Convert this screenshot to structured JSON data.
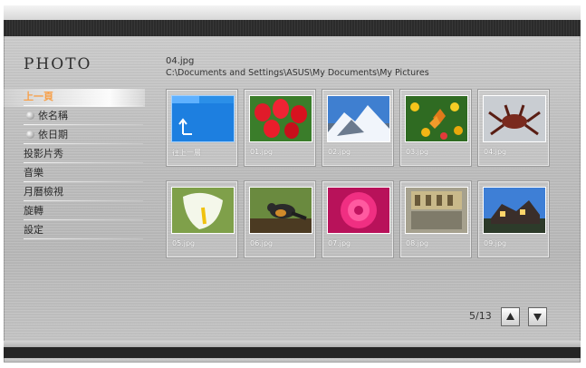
{
  "app": {
    "title": "PHOTO"
  },
  "sidebar": {
    "items": [
      {
        "label": "上一頁",
        "active": true
      },
      {
        "label": "依名稱",
        "sub": true
      },
      {
        "label": "依日期",
        "sub": true
      },
      {
        "label": "投影片秀"
      },
      {
        "label": "音樂"
      },
      {
        "label": "月曆檢視"
      },
      {
        "label": "旋轉"
      },
      {
        "label": "設定"
      }
    ]
  },
  "header": {
    "filename": "04.jpg",
    "path": "C:\\Documents and Settings\\ASUS\\My Documents\\My Pictures"
  },
  "tiles": [
    {
      "caption": "往上一層",
      "icon": "folder-up-icon"
    },
    {
      "caption": "01.jpg",
      "subject": "red tulips"
    },
    {
      "caption": "02.jpg",
      "subject": "snowy mountain"
    },
    {
      "caption": "03.jpg",
      "subject": "butterfly on flowers"
    },
    {
      "caption": "04.jpg",
      "subject": "crab on sand"
    },
    {
      "caption": "05.jpg",
      "subject": "white calla lily"
    },
    {
      "caption": "06.jpg",
      "subject": "bird on branch"
    },
    {
      "caption": "07.jpg",
      "subject": "pink rose"
    },
    {
      "caption": "08.jpg",
      "subject": "building reflection"
    },
    {
      "caption": "09.jpg",
      "subject": "house on hill"
    }
  ],
  "pager": {
    "label": "5/13",
    "up_icon": "triangle-up-icon",
    "down_icon": "triangle-down-icon"
  },
  "colors": {
    "accent": "#f7a04a",
    "text": "#2b2b2b",
    "folder": "#2d8fe6"
  }
}
